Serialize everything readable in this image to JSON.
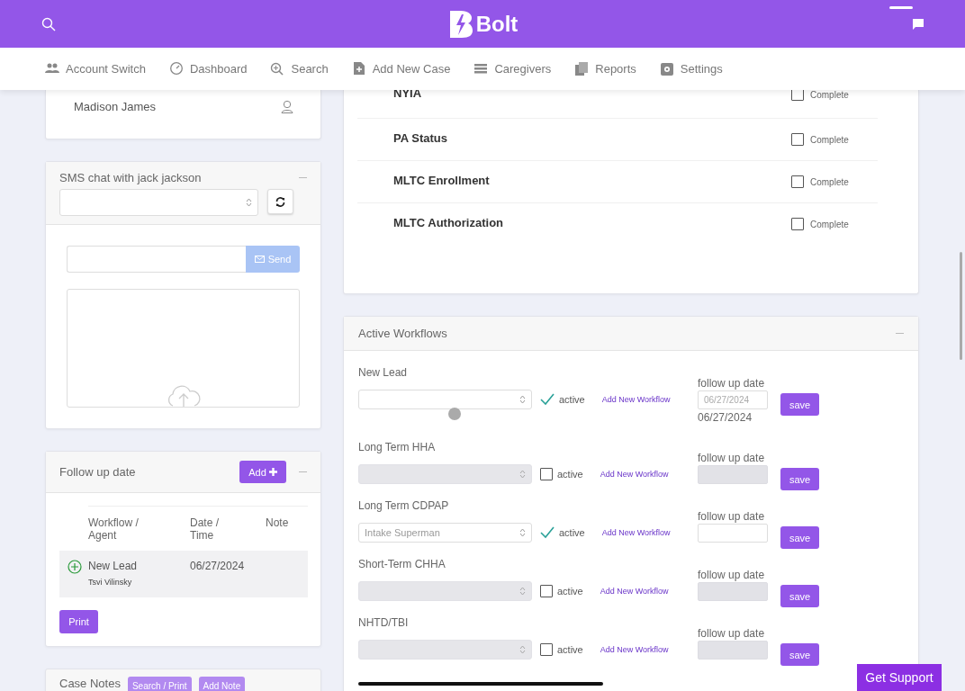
{
  "header": {
    "logo": "Bolt"
  },
  "nav": [
    {
      "label": "Account Switch"
    },
    {
      "label": "Dashboard"
    },
    {
      "label": "Search"
    },
    {
      "label": "Add New Case"
    },
    {
      "label": "Caregivers"
    },
    {
      "label": "Reports"
    },
    {
      "label": "Settings"
    }
  ],
  "profile_card": {
    "name": "Madison James"
  },
  "sms_chat": {
    "title": "SMS chat with jack jackson",
    "send_button": "Send"
  },
  "follow_up": {
    "title": "Follow up date",
    "add_button": "Add",
    "columns": [
      "Workflow / Agent",
      "Date / Time",
      "Note"
    ],
    "rows": [
      {
        "workflow": "New Lead",
        "agent": "Tsvi Vilinsky",
        "date": "06/27/2024"
      }
    ],
    "print_button": "Print"
  },
  "case_notes": {
    "title": "Case Notes",
    "buttons": [
      "Search / Print",
      "Add Note"
    ]
  },
  "checklist": [
    {
      "label": "NYIA",
      "checked": false,
      "status": "Complete"
    },
    {
      "label": "PA Status",
      "checked": false,
      "status": "Complete"
    },
    {
      "label": "MLTC Enrollment",
      "checked": false,
      "status": "Complete"
    },
    {
      "label": "MLTC Authorization",
      "checked": false,
      "status": "Complete"
    }
  ],
  "workflows": {
    "title": "Active Workflows",
    "items": [
      {
        "name": "New Lead",
        "disabled": false,
        "active": true,
        "active_label": "active",
        "link": "Add New Workflow",
        "date_label": "follow up date",
        "date_value": "06/27/2024",
        "date_text": "06/27/2024",
        "save": "save"
      },
      {
        "name": "Long Term HHA",
        "disabled": true,
        "active": false,
        "active_label": "active",
        "link": "Add New Workflow",
        "date_label": "follow up date",
        "save": "save"
      },
      {
        "name": "Long Term CDPAP",
        "agent": "Intake Superman",
        "disabled": false,
        "active": true,
        "active_label": "active",
        "link": "Add New Workflow",
        "date_label": "follow up date",
        "save": "save"
      },
      {
        "name": "Short-Term CHHA",
        "disabled": true,
        "active": false,
        "active_label": "active",
        "link": "Add New Workflow",
        "date_label": "follow up date",
        "save": "save"
      },
      {
        "name": "NHTD/TBI",
        "disabled": true,
        "active": false,
        "active_label": "active",
        "link": "Add New Workflow",
        "date_label": "follow up date",
        "save": "save"
      }
    ]
  },
  "support_button": "Get Support"
}
